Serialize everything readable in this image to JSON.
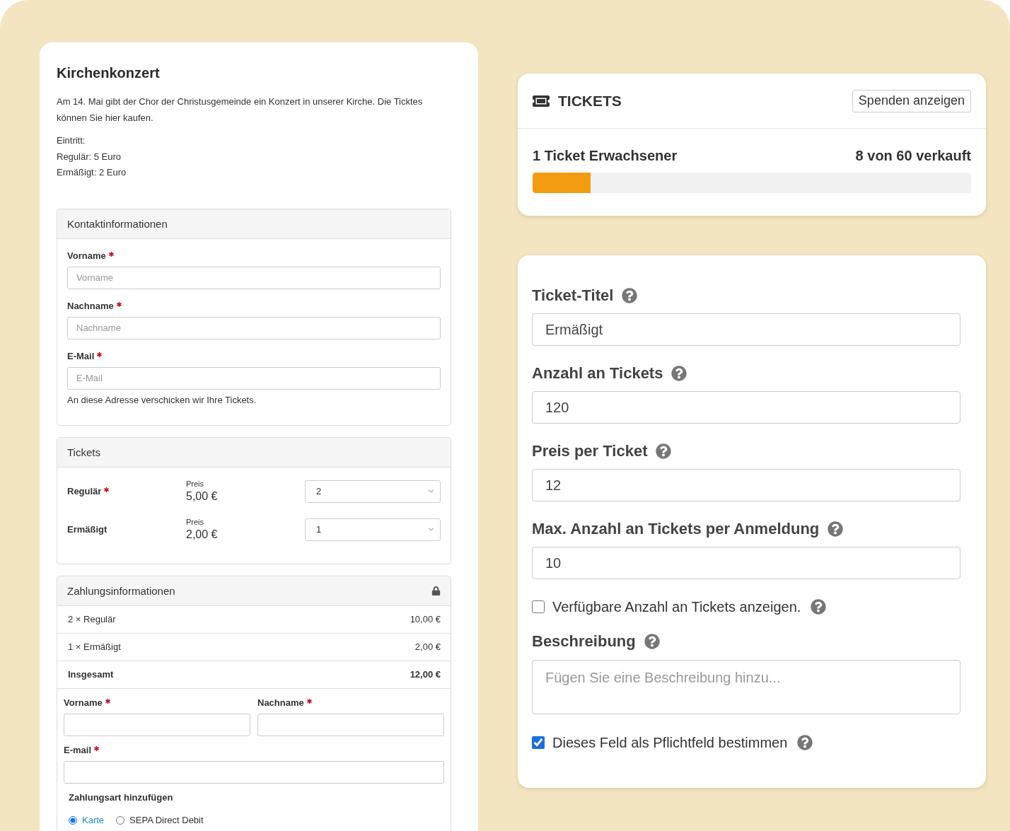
{
  "event": {
    "title": "Kirchenkonzert",
    "description": "Am 14. Mai gibt der Chor der Christusgemeinde ein Konzert in unserer Kirche. Die Ticktes können Sie hier kaufen.",
    "admission": [
      "Eintritt:",
      "Regulär: 5 Euro",
      "Ermäßigt: 2 Euro"
    ]
  },
  "contact": {
    "title": "Kontaktinformationen",
    "fields": [
      {
        "label": "Vorname",
        "required": true,
        "placeholder": "Vorname"
      },
      {
        "label": "Nachname",
        "required": true,
        "placeholder": "Nachname"
      },
      {
        "label": "E-Mail",
        "required": true,
        "placeholder": "E-Mail"
      }
    ],
    "hint": "An diese Adresse verschicken wir Ihre Tickets."
  },
  "tickets": {
    "title": "Tickets",
    "rows": [
      {
        "name": "Regulär",
        "required": true,
        "price_label": "Preis",
        "price": "5,00 €",
        "quantity": "2"
      },
      {
        "name": "Ermäßigt",
        "required": false,
        "price_label": "Preis",
        "price": "2,00 €",
        "quantity": "1"
      }
    ]
  },
  "payment": {
    "title": "Zahlungsinformationen",
    "lines": [
      {
        "kind": "item",
        "label": "2 × Regulär",
        "amount": "10,00 €"
      },
      {
        "kind": "item",
        "label": "1 × Ermäßigt",
        "amount": "2,00 €"
      },
      {
        "kind": "total",
        "label": "Insgesamt",
        "amount": "12,00 €"
      }
    ],
    "fields": [
      {
        "label": "Vorname",
        "required": true
      },
      {
        "label": "Nachname",
        "required": true
      },
      {
        "label": "E-mail",
        "required": true
      }
    ],
    "method_title": "Zahlungsart hinzufügen",
    "methods": [
      {
        "label": "Karte",
        "selected": true
      },
      {
        "label": "SEPA Direct Debit",
        "selected": false
      }
    ]
  },
  "widget": {
    "title": "TICKETS",
    "button": "Spenden anzeigen",
    "ticket": {
      "name": "1 Ticket Erwachsener",
      "sold": "8 von 60 verkauft",
      "level": 0.133
    }
  },
  "ticket_form": {
    "fields": [
      {
        "kind": "input",
        "label": "Ticket-Titel",
        "value": "Ermäßigt"
      },
      {
        "kind": "input",
        "label": "Anzahl an Tickets",
        "value": "120"
      },
      {
        "kind": "input",
        "label": "Preis per Ticket",
        "value": "12"
      },
      {
        "kind": "input",
        "label": "Max. Anzahl an Tickets per Anmeldung",
        "value": "10"
      },
      {
        "kind": "checkbox",
        "label": "Verfügbare Anzahl an Tickets anzeigen.",
        "checked": false
      },
      {
        "kind": "textarea",
        "label": "Beschreibung",
        "placeholder": "Fügen Sie eine Beschreibung hinzu..."
      },
      {
        "kind": "checkbox",
        "label": "Dieses Feld als Pflichtfeld bestimmen",
        "checked": true
      }
    ]
  }
}
